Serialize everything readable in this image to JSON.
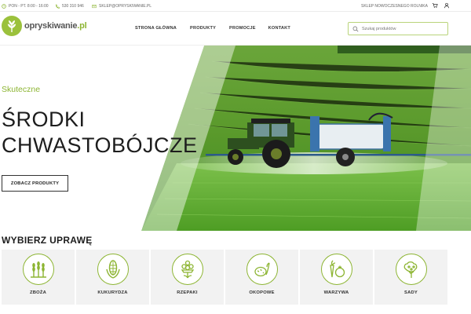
{
  "topbar": {
    "hours": "PON - PT. 8:00 - 16:00",
    "phone": "530 310 946",
    "email": "SKLEP@OPRYSKIWANIE.PL",
    "shop_link": "SKLEP NOWOCZESNEGO ROLNIKA",
    "icons": [
      "clock-icon",
      "phone-icon",
      "mail-icon",
      "cart-icon",
      "user-icon"
    ]
  },
  "header": {
    "logo_text_main": "opryskiwanie",
    "logo_text_suffix": ".pl",
    "nav": [
      "STRONA GŁÓWNA",
      "PRODUKTY",
      "PROMOCJE",
      "KONTAKT"
    ],
    "search_placeholder": "Szukaj produktów"
  },
  "hero": {
    "kicker": "Skuteczne",
    "title_line1": "ŚRODKI",
    "title_line2": "CHWASTOBÓJCZE",
    "cta": "ZOBACZ PRODUKTY"
  },
  "crops": {
    "heading": "WYBIERZ UPRAWĘ",
    "items": [
      {
        "label": "ZBOŻA",
        "icon": "wheat-icon"
      },
      {
        "label": "KUKURYDZA",
        "icon": "corn-icon"
      },
      {
        "label": "RZEPAKI",
        "icon": "rapeseed-icon"
      },
      {
        "label": "OKOPOWE",
        "icon": "root-crop-icon"
      },
      {
        "label": "WARZYWA",
        "icon": "vegetables-icon"
      },
      {
        "label": "SADY",
        "icon": "orchard-tree-icon"
      }
    ]
  },
  "colors": {
    "accent_green": "#8db533",
    "dark_text": "#1d1d1d",
    "tile_bg": "#f2f2f2"
  }
}
